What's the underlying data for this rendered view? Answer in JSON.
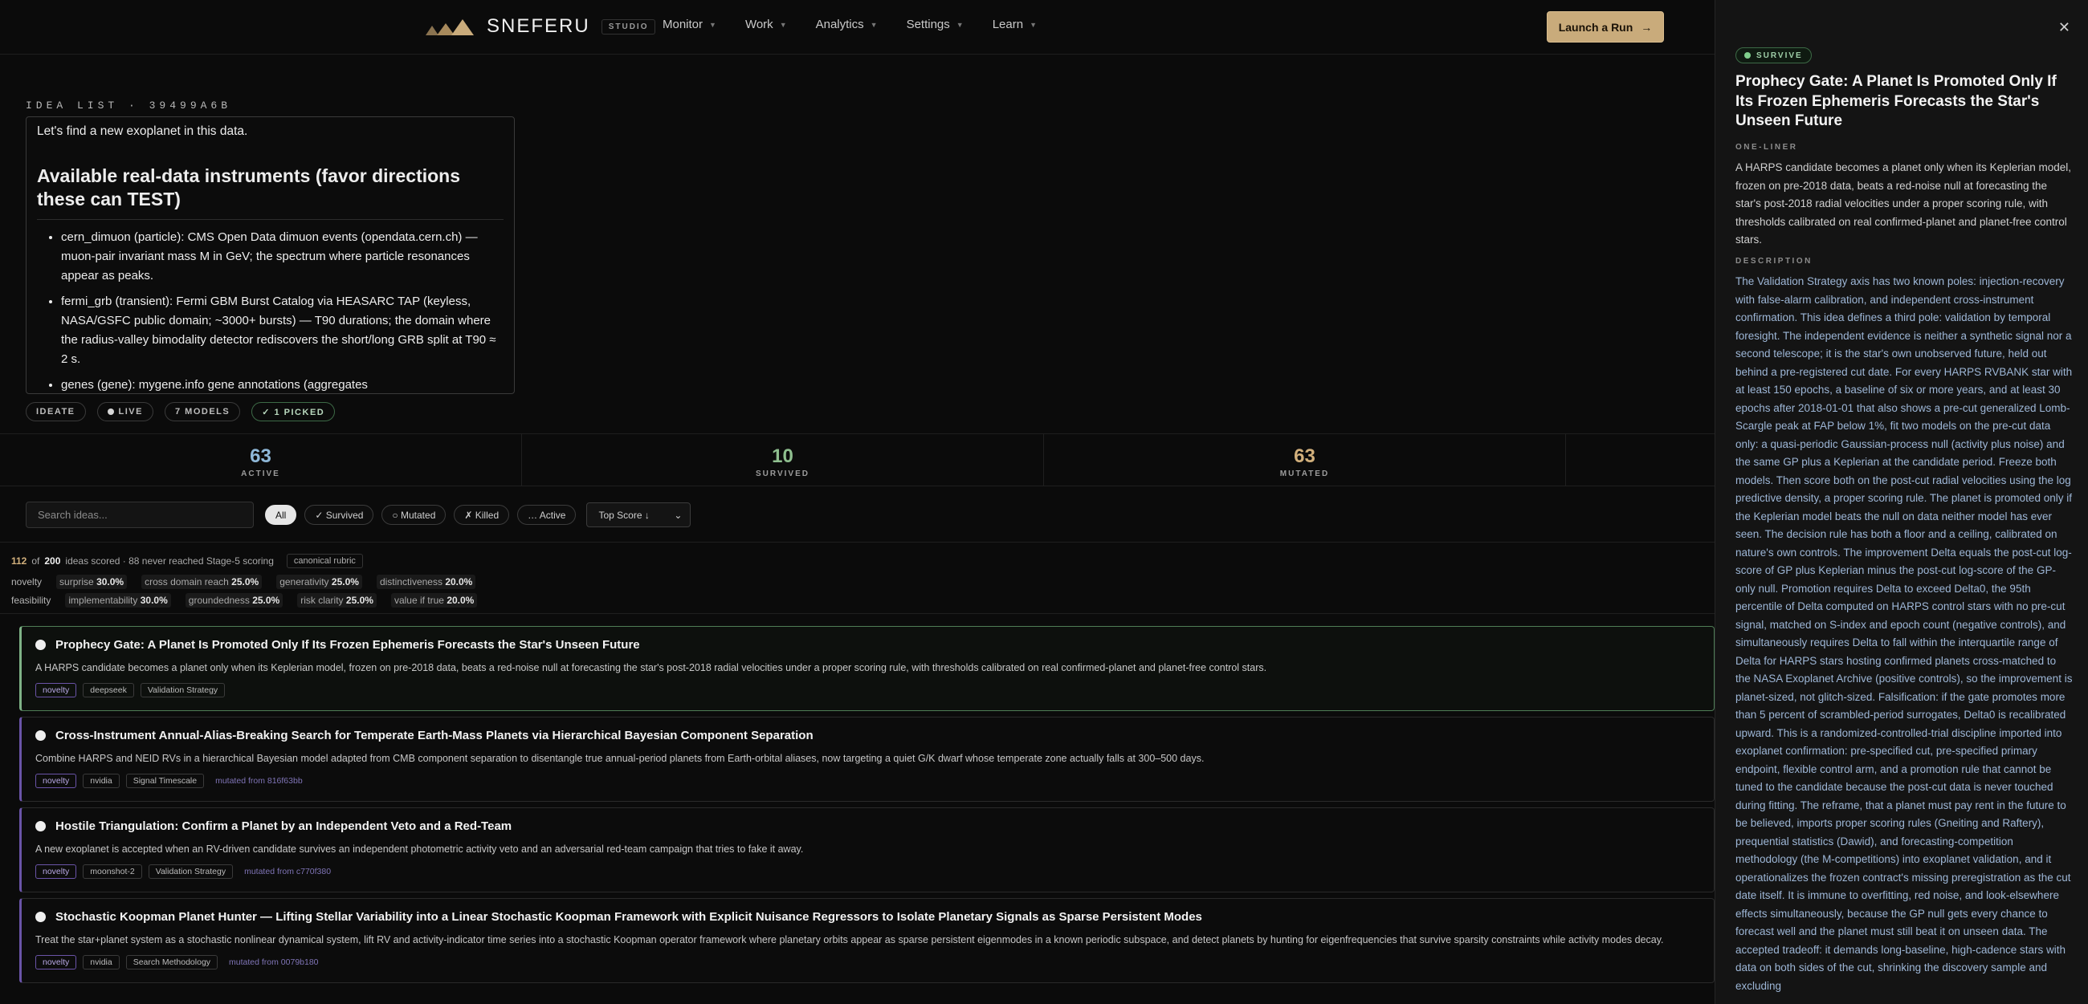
{
  "brand": {
    "name": "SNEFERU",
    "badge": "STUDIO"
  },
  "nav": {
    "items": [
      {
        "label": "Monitor"
      },
      {
        "label": "Work"
      },
      {
        "label": "Analytics"
      },
      {
        "label": "Settings"
      },
      {
        "label": "Learn"
      }
    ],
    "launch_label": "Launch a Run",
    "launch_arrow": "→"
  },
  "idea_list": {
    "label": "IDEA LIST · 39499A6B",
    "intro": "Let's find a new exoplanet in this data.",
    "heading": "Available real-data instruments (favor directions these can TEST)",
    "instruments": [
      "cern_dimuon (particle): CMS Open Data dimuon events (opendata.cern.ch) — muon-pair invariant mass M in GeV; the spectrum where particle resonances appear as peaks.",
      "fermi_grb (transient): Fermi GBM Burst Catalog via HEASARC TAP (keyless, NASA/GSFC public domain; ~3000+ bursts) — T90 durations; the domain where the radius-valley bimodality detector rediscovers the short/long GRB split at T90 ≈ 2 s.",
      "genes (gene): mygene.info gene annotations (aggregates"
    ],
    "pills": {
      "ideate": "IDEATE",
      "live": "LIVE",
      "models": "7 MODELS",
      "picked": "✓ 1 PICKED"
    }
  },
  "stats": [
    {
      "value": "63",
      "label": "ACTIVE"
    },
    {
      "value": "10",
      "label": "SURVIVED"
    },
    {
      "value": "63",
      "label": "MUTATED"
    }
  ],
  "filters": {
    "search_placeholder": "Search ideas...",
    "chips": [
      "All",
      "✓ Survived",
      "○ Mutated",
      "✗ Killed",
      "… Active"
    ],
    "sort_label": "Top Score ↓",
    "sort_arrow": "⌄"
  },
  "scoring": {
    "scored": "112",
    "of_text": "of",
    "total": "200",
    "suffix": "ideas scored · 88 never reached Stage-5 scoring",
    "rubric": "canonical rubric",
    "row1_label": "novelty",
    "row1": [
      {
        "name": "surprise",
        "value": "30.0%"
      },
      {
        "name": "cross domain reach",
        "value": "25.0%"
      },
      {
        "name": "generativity",
        "value": "25.0%"
      },
      {
        "name": "distinctiveness",
        "value": "20.0%"
      }
    ],
    "row2_label": "feasibility",
    "row2": [
      {
        "name": "implementability",
        "value": "30.0%"
      },
      {
        "name": "groundedness",
        "value": "25.0%"
      },
      {
        "name": "risk clarity",
        "value": "25.0%"
      },
      {
        "name": "value if true",
        "value": "20.0%"
      }
    ]
  },
  "cards": [
    {
      "title": "Prophecy Gate: A Planet Is Promoted Only If Its Frozen Ephemeris Forecasts the Star's Unseen Future",
      "desc": "A HARPS candidate becomes a planet only when its Keplerian model, frozen on pre-2018 data, beats a red-noise null at forecasting the star's post-2018 radial velocities under a proper scoring rule, with thresholds calibrated on real confirmed-planet and planet-free control stars.",
      "tags": [
        "novelty",
        "deepseek",
        "Validation Strategy"
      ],
      "mutated": ""
    },
    {
      "title": "Cross-Instrument Annual-Alias-Breaking Search for Temperate Earth-Mass Planets via Hierarchical Bayesian Component Separation",
      "desc": "Combine HARPS and NEID RVs in a hierarchical Bayesian model adapted from CMB component separation to disentangle true annual-period planets from Earth-orbital aliases, now targeting a quiet G/K dwarf whose temperate zone actually falls at 300–500 days.",
      "tags": [
        "novelty",
        "nvidia",
        "Signal Timescale"
      ],
      "mutated": "mutated from 816f63bb"
    },
    {
      "title": "Hostile Triangulation: Confirm a Planet by an Independent Veto and a Red-Team",
      "desc": "A new exoplanet is accepted when an RV-driven candidate survives an independent photometric activity veto and an adversarial red-team campaign that tries to fake it away.",
      "tags": [
        "novelty",
        "moonshot-2",
        "Validation Strategy"
      ],
      "mutated": "mutated from c770f380"
    },
    {
      "title": "Stochastic Koopman Planet Hunter — Lifting Stellar Variability into a Linear Stochastic Koopman Framework with Explicit Nuisance Regressors to Isolate Planetary Signals as Sparse Persistent Modes",
      "desc": "Treat the star+planet system as a stochastic nonlinear dynamical system, lift RV and activity-indicator time series into a stochastic Koopman operator framework where planetary orbits appear as sparse persistent eigenmodes in a known periodic subspace, and detect planets by hunting for eigenfrequencies that survive sparsity constraints while activity modes decay.",
      "tags": [
        "novelty",
        "nvidia",
        "Search Methodology"
      ],
      "mutated": "mutated from 0079b180"
    }
  ],
  "panel": {
    "status": "SURVIVE",
    "title": "Prophecy Gate: A Planet Is Promoted Only If Its Frozen Ephemeris Forecasts the Star's Unseen Future",
    "oneliner_label": "ONE-LINER",
    "oneliner": "A HARPS candidate becomes a planet only when its Keplerian model, frozen on pre-2018 data, beats a red-noise null at forecasting the star's post-2018 radial velocities under a proper scoring rule, with thresholds calibrated on real confirmed-planet and planet-free control stars.",
    "description_label": "DESCRIPTION",
    "description": "The Validation Strategy axis has two known poles: injection-recovery with false-alarm calibration, and independent cross-instrument confirmation. This idea defines a third pole: validation by temporal foresight. The independent evidence is neither a synthetic signal nor a second telescope; it is the star's own unobserved future, held out behind a pre-registered cut date. For every HARPS RVBANK star with at least 150 epochs, a baseline of six or more years, and at least 30 epochs after 2018-01-01 that also shows a pre-cut generalized Lomb-Scargle peak at FAP below 1%, fit two models on the pre-cut data only: a quasi-periodic Gaussian-process null (activity plus noise) and the same GP plus a Keplerian at the candidate period. Freeze both models. Then score both on the post-cut radial velocities using the log predictive density, a proper scoring rule. The planet is promoted only if the Keplerian model beats the null on data neither model has ever seen. The decision rule has both a floor and a ceiling, calibrated on nature's own controls. The improvement Delta equals the post-cut log-score of GP plus Keplerian minus the post-cut log-score of the GP-only null. Promotion requires Delta to exceed Delta0, the 95th percentile of Delta computed on HARPS control stars with no pre-cut signal, matched on S-index and epoch count (negative controls), and simultaneously requires Delta to fall within the interquartile range of Delta for HARPS stars hosting confirmed planets cross-matched to the NASA Exoplanet Archive (positive controls), so the improvement is planet-sized, not glitch-sized. Falsification: if the gate promotes more than 5 percent of scrambled-period surrogates, Delta0 is recalibrated upward. This is a randomized-controlled-trial discipline imported into exoplanet confirmation: pre-specified cut, pre-specified primary endpoint, flexible control arm, and a promotion rule that cannot be tuned to the candidate because the post-cut data is never touched during fitting. The reframe, that a planet must pay rent in the future to be believed, imports proper scoring rules (Gneiting and Raftery), prequential statistics (Dawid), and forecasting-competition methodology (the M-competitions) into exoplanet validation, and it operationalizes the frozen contract's missing preregistration as the cut date itself. It is immune to overfitting, red noise, and look-elsewhere effects simultaneously, because the GP null gets every chance to forecast well and the planet must still beat it on unseen data. The accepted tradeoff: it demands long-baseline, high-cadence stars with data on both sides of the cut, shrinking the discovery sample and excluding"
  }
}
